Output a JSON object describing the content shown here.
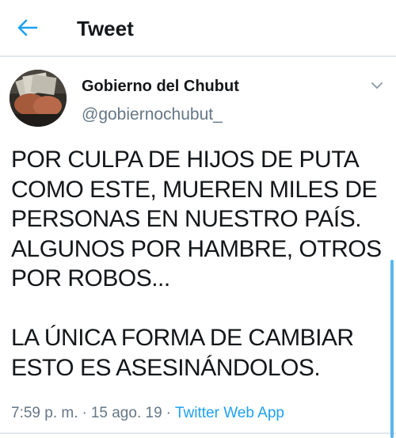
{
  "header": {
    "title": "Tweet",
    "back_icon": "arrow-left-icon",
    "accent_color": "#1da1f2"
  },
  "tweet": {
    "author": {
      "name": "Gobierno del Chubut",
      "handle": "@gobiernochubut_"
    },
    "text": "POR CULPA DE HIJOS DE PUTA COMO ESTE, MUEREN MILES DE PERSONAS EN NUESTRO PAÍS. ALGUNOS POR HAMBRE, OTROS POR ROBOS...\n\nLA ÚNICA FORMA DE CAMBIAR ESTO ES ASESINÁNDOLOS.",
    "time": "7:59 p. m.",
    "separator": "·",
    "date": "15 ago. 19",
    "source": "Twitter Web App",
    "menu_icon": "chevron-down-icon"
  }
}
